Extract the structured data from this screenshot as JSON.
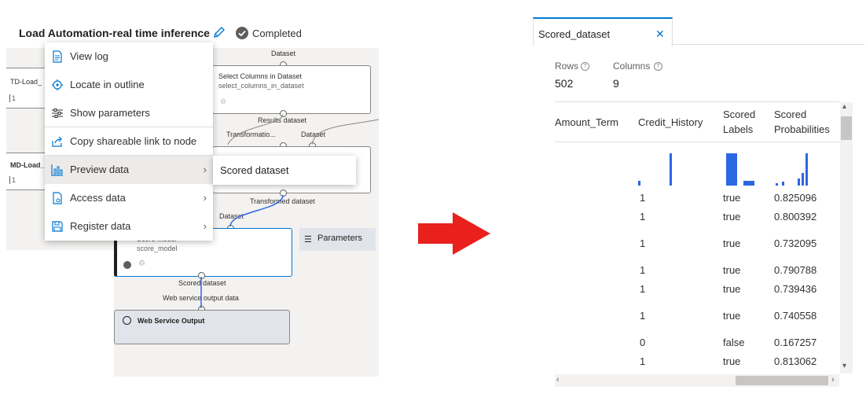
{
  "header": {
    "title": "Load Automation-real time inference",
    "status_label": "Completed",
    "edit_icon": "pencil-icon",
    "status_icon": "checkmark-circle-icon"
  },
  "pipeline": {
    "left_nodes": [
      "TD-Load_",
      "MD-Load_"
    ],
    "left_node_badge": "1",
    "select_columns": {
      "title": "Select Columns in Dataset",
      "subtitle": "select_columns_in_dataset"
    },
    "score_model": {
      "title": "Score Model",
      "subtitle": "score_model"
    },
    "web_service_output": {
      "title": "Web Service Output",
      "icon": "globe-icon"
    },
    "port_labels": {
      "dataset_top": "Dataset",
      "results_dataset": "Results dataset",
      "transformation": "Transformatio...",
      "dataset_mid": "Dataset",
      "transformed_dataset": "Transformed dataset",
      "dataset_low": "Dataset",
      "scored_dataset": "Scored dataset",
      "web_service_output_data": "Web service output data"
    },
    "parameters_button": "Parameters"
  },
  "context_menu": {
    "items": [
      {
        "label": "View log",
        "icon": "document-icon"
      },
      {
        "label": "Locate in outline",
        "icon": "locate-icon"
      },
      {
        "label": "Show parameters",
        "icon": "parameters-icon"
      },
      {
        "label": "Copy shareable link to node",
        "icon": "share-icon"
      },
      {
        "label": "Preview data",
        "icon": "chart-icon"
      },
      {
        "label": "Access data",
        "icon": "file-access-icon"
      },
      {
        "label": "Register data",
        "icon": "save-icon"
      }
    ],
    "submenu_item": "Scored dataset"
  },
  "accent": {
    "arrow": "#e8211d",
    "highlight": "#0078d4",
    "bar": "#2b66e3"
  },
  "preview": {
    "tab_label": "Scored_dataset",
    "close_icon": "close-icon",
    "rows_label": "Rows",
    "rows_value": "502",
    "columns_label": "Columns",
    "columns_value": "9",
    "info_icon": "info-icon",
    "columns": [
      {
        "line1": "Amount_Term",
        "line2": ""
      },
      {
        "line1": "Credit_History",
        "line2": ""
      },
      {
        "line1": "Scored",
        "line2": "Labels"
      },
      {
        "line1": "Scored",
        "line2": "Probabilities"
      }
    ],
    "rows": [
      [
        "",
        "1",
        "true",
        "0.825096"
      ],
      [
        "",
        "1",
        "true",
        "0.800392"
      ],
      [
        "",
        "1",
        "true",
        "0.732095"
      ],
      [
        "",
        "1",
        "true",
        "0.790788"
      ],
      [
        "",
        "1",
        "true",
        "0.739436"
      ],
      [
        "",
        "1",
        "true",
        "0.740558"
      ],
      [
        "",
        "0",
        "false",
        "0.167257"
      ],
      [
        "",
        "1",
        "true",
        "0.813062"
      ]
    ]
  }
}
